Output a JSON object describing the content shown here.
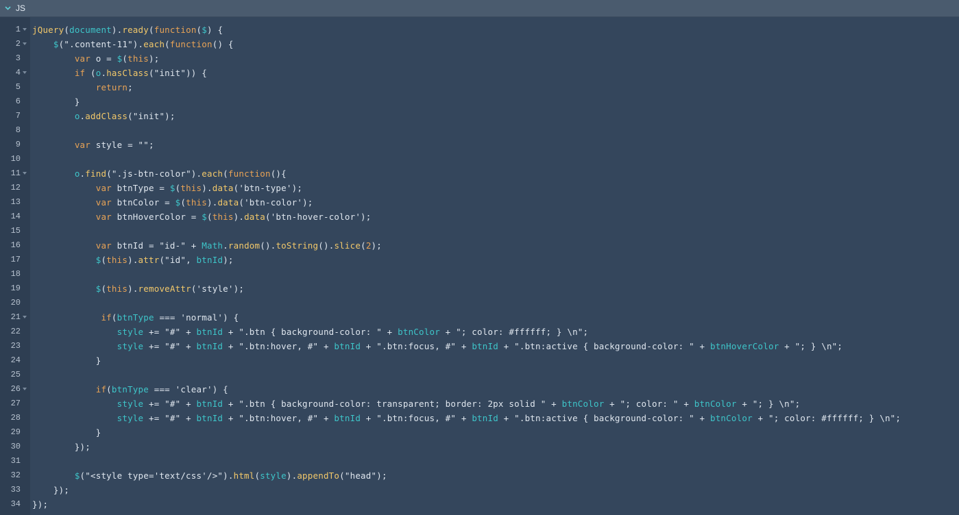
{
  "panel": {
    "title": "JS"
  },
  "lines": [
    {
      "n": "1",
      "fold": true,
      "t": [
        [
          "jQuery",
          "fn"
        ],
        [
          "(",
          ""
        ],
        [
          "document",
          "var"
        ],
        [
          ").",
          ""
        ],
        [
          "ready",
          "fn"
        ],
        [
          "(",
          ""
        ],
        [
          "function",
          "kw"
        ],
        [
          "(",
          ""
        ],
        [
          "$",
          "var"
        ],
        [
          ") {",
          ""
        ]
      ]
    },
    {
      "n": "2",
      "fold": true,
      "t": [
        [
          "    ",
          ""
        ],
        [
          "$",
          "var"
        ],
        [
          "(\".content-11\").",
          ""
        ],
        [
          "each",
          "fn"
        ],
        [
          "(",
          ""
        ],
        [
          "function",
          "kw"
        ],
        [
          "() {",
          ""
        ]
      ]
    },
    {
      "n": "3",
      "fold": false,
      "t": [
        [
          "        ",
          ""
        ],
        [
          "var",
          "kw"
        ],
        [
          " o = ",
          ""
        ],
        [
          "$",
          "var"
        ],
        [
          "(",
          ""
        ],
        [
          "this",
          "kw"
        ],
        [
          ");",
          ""
        ]
      ]
    },
    {
      "n": "4",
      "fold": true,
      "t": [
        [
          "        ",
          ""
        ],
        [
          "if",
          "kw"
        ],
        [
          " (",
          ""
        ],
        [
          "o",
          "var"
        ],
        [
          ".",
          ""
        ],
        [
          "hasClass",
          "fn"
        ],
        [
          "(\"init\")) {",
          ""
        ]
      ]
    },
    {
      "n": "5",
      "fold": false,
      "t": [
        [
          "            ",
          ""
        ],
        [
          "return",
          "kw"
        ],
        [
          ";",
          ""
        ]
      ]
    },
    {
      "n": "6",
      "fold": false,
      "t": [
        [
          "        }",
          ""
        ]
      ]
    },
    {
      "n": "7",
      "fold": false,
      "t": [
        [
          "        ",
          ""
        ],
        [
          "o",
          "var"
        ],
        [
          ".",
          ""
        ],
        [
          "addClass",
          "fn"
        ],
        [
          "(\"init\");",
          ""
        ]
      ]
    },
    {
      "n": "8",
      "fold": false,
      "t": []
    },
    {
      "n": "9",
      "fold": false,
      "t": [
        [
          "        ",
          ""
        ],
        [
          "var",
          "kw"
        ],
        [
          " style = \"\";",
          ""
        ]
      ]
    },
    {
      "n": "10",
      "fold": false,
      "t": []
    },
    {
      "n": "11",
      "fold": true,
      "t": [
        [
          "        ",
          ""
        ],
        [
          "o",
          "var"
        ],
        [
          ".",
          ""
        ],
        [
          "find",
          "fn"
        ],
        [
          "(\".js-btn-color\").",
          ""
        ],
        [
          "each",
          "fn"
        ],
        [
          "(",
          ""
        ],
        [
          "function",
          "kw"
        ],
        [
          "(){",
          ""
        ]
      ]
    },
    {
      "n": "12",
      "fold": false,
      "t": [
        [
          "            ",
          ""
        ],
        [
          "var",
          "kw"
        ],
        [
          " btnType = ",
          ""
        ],
        [
          "$",
          "var"
        ],
        [
          "(",
          ""
        ],
        [
          "this",
          "kw"
        ],
        [
          ").",
          ""
        ],
        [
          "data",
          "fn"
        ],
        [
          "('btn-type');",
          ""
        ]
      ]
    },
    {
      "n": "13",
      "fold": false,
      "t": [
        [
          "            ",
          ""
        ],
        [
          "var",
          "kw"
        ],
        [
          " btnColor = ",
          ""
        ],
        [
          "$",
          "var"
        ],
        [
          "(",
          ""
        ],
        [
          "this",
          "kw"
        ],
        [
          ").",
          ""
        ],
        [
          "data",
          "fn"
        ],
        [
          "('btn-color');",
          ""
        ]
      ]
    },
    {
      "n": "14",
      "fold": false,
      "t": [
        [
          "            ",
          ""
        ],
        [
          "var",
          "kw"
        ],
        [
          " btnHoverColor = ",
          ""
        ],
        [
          "$",
          "var"
        ],
        [
          "(",
          ""
        ],
        [
          "this",
          "kw"
        ],
        [
          ").",
          ""
        ],
        [
          "data",
          "fn"
        ],
        [
          "('btn-hover-color');",
          ""
        ]
      ]
    },
    {
      "n": "15",
      "fold": false,
      "t": []
    },
    {
      "n": "16",
      "fold": false,
      "t": [
        [
          "            ",
          ""
        ],
        [
          "var",
          "kw"
        ],
        [
          " btnId = \"id-\" + ",
          ""
        ],
        [
          "Math",
          "var"
        ],
        [
          ".",
          ""
        ],
        [
          "random",
          "fn"
        ],
        [
          "().",
          ""
        ],
        [
          "toString",
          "fn"
        ],
        [
          "().",
          ""
        ],
        [
          "slice",
          "fn"
        ],
        [
          "(",
          ""
        ],
        [
          "2",
          "num"
        ],
        [
          ");",
          ""
        ]
      ]
    },
    {
      "n": "17",
      "fold": false,
      "t": [
        [
          "            ",
          ""
        ],
        [
          "$",
          "var"
        ],
        [
          "(",
          ""
        ],
        [
          "this",
          "kw"
        ],
        [
          ").",
          ""
        ],
        [
          "attr",
          "fn"
        ],
        [
          "(\"id\", ",
          ""
        ],
        [
          "btnId",
          "var"
        ],
        [
          ");",
          ""
        ]
      ]
    },
    {
      "n": "18",
      "fold": false,
      "t": []
    },
    {
      "n": "19",
      "fold": false,
      "t": [
        [
          "            ",
          ""
        ],
        [
          "$",
          "var"
        ],
        [
          "(",
          ""
        ],
        [
          "this",
          "kw"
        ],
        [
          ").",
          ""
        ],
        [
          "removeAttr",
          "fn"
        ],
        [
          "('style');",
          ""
        ]
      ]
    },
    {
      "n": "20",
      "fold": false,
      "t": []
    },
    {
      "n": "21",
      "fold": true,
      "t": [
        [
          "             ",
          ""
        ],
        [
          "if",
          "kw"
        ],
        [
          "(",
          ""
        ],
        [
          "btnType",
          "var"
        ],
        [
          " === 'normal') {",
          ""
        ]
      ]
    },
    {
      "n": "22",
      "fold": false,
      "t": [
        [
          "                ",
          ""
        ],
        [
          "style",
          "var"
        ],
        [
          " += \"#\" + ",
          ""
        ],
        [
          "btnId",
          "var"
        ],
        [
          " + \".btn { background-color: \" + ",
          ""
        ],
        [
          "btnColor",
          "var"
        ],
        [
          " + \"; color: #ffffff; } \\n\";",
          ""
        ]
      ]
    },
    {
      "n": "23",
      "fold": false,
      "t": [
        [
          "                ",
          ""
        ],
        [
          "style",
          "var"
        ],
        [
          " += \"#\" + ",
          ""
        ],
        [
          "btnId",
          "var"
        ],
        [
          " + \".btn:hover, #\" + ",
          ""
        ],
        [
          "btnId",
          "var"
        ],
        [
          " + \".btn:focus, #\" + ",
          ""
        ],
        [
          "btnId",
          "var"
        ],
        [
          " + \".btn:active { background-color: \" + ",
          ""
        ],
        [
          "btnHoverColor",
          "var"
        ],
        [
          " + \"; } \\n\";",
          ""
        ]
      ]
    },
    {
      "n": "24",
      "fold": false,
      "t": [
        [
          "            }",
          ""
        ]
      ]
    },
    {
      "n": "25",
      "fold": false,
      "t": []
    },
    {
      "n": "26",
      "fold": true,
      "t": [
        [
          "            ",
          ""
        ],
        [
          "if",
          "kw"
        ],
        [
          "(",
          ""
        ],
        [
          "btnType",
          "var"
        ],
        [
          " === 'clear') {",
          ""
        ]
      ]
    },
    {
      "n": "27",
      "fold": false,
      "t": [
        [
          "                ",
          ""
        ],
        [
          "style",
          "var"
        ],
        [
          " += \"#\" + ",
          ""
        ],
        [
          "btnId",
          "var"
        ],
        [
          " + \".btn { background-color: transparent; border: 2px solid \" + ",
          ""
        ],
        [
          "btnColor",
          "var"
        ],
        [
          " + \"; color: \" + ",
          ""
        ],
        [
          "btnColor",
          "var"
        ],
        [
          " + \"; } \\n\";",
          ""
        ]
      ]
    },
    {
      "n": "28",
      "fold": false,
      "t": [
        [
          "                ",
          ""
        ],
        [
          "style",
          "var"
        ],
        [
          " += \"#\" + ",
          ""
        ],
        [
          "btnId",
          "var"
        ],
        [
          " + \".btn:hover, #\" + ",
          ""
        ],
        [
          "btnId",
          "var"
        ],
        [
          " + \".btn:focus, #\" + ",
          ""
        ],
        [
          "btnId",
          "var"
        ],
        [
          " + \".btn:active { background-color: \" + ",
          ""
        ],
        [
          "btnColor",
          "var"
        ],
        [
          " + \"; color: #ffffff; } \\n\";",
          ""
        ]
      ]
    },
    {
      "n": "29",
      "fold": false,
      "t": [
        [
          "            }",
          ""
        ]
      ]
    },
    {
      "n": "30",
      "fold": false,
      "t": [
        [
          "        });",
          ""
        ]
      ]
    },
    {
      "n": "31",
      "fold": false,
      "t": []
    },
    {
      "n": "32",
      "fold": false,
      "t": [
        [
          "        ",
          ""
        ],
        [
          "$",
          "var"
        ],
        [
          "(\"<style type='text/css'/>\").",
          ""
        ],
        [
          "html",
          "fn"
        ],
        [
          "(",
          ""
        ],
        [
          "style",
          "var"
        ],
        [
          ").",
          ""
        ],
        [
          "appendTo",
          "fn"
        ],
        [
          "(\"head\");",
          ""
        ]
      ]
    },
    {
      "n": "33",
      "fold": false,
      "t": [
        [
          "    });",
          ""
        ]
      ]
    },
    {
      "n": "34",
      "fold": false,
      "t": [
        [
          "});",
          ""
        ]
      ]
    }
  ]
}
